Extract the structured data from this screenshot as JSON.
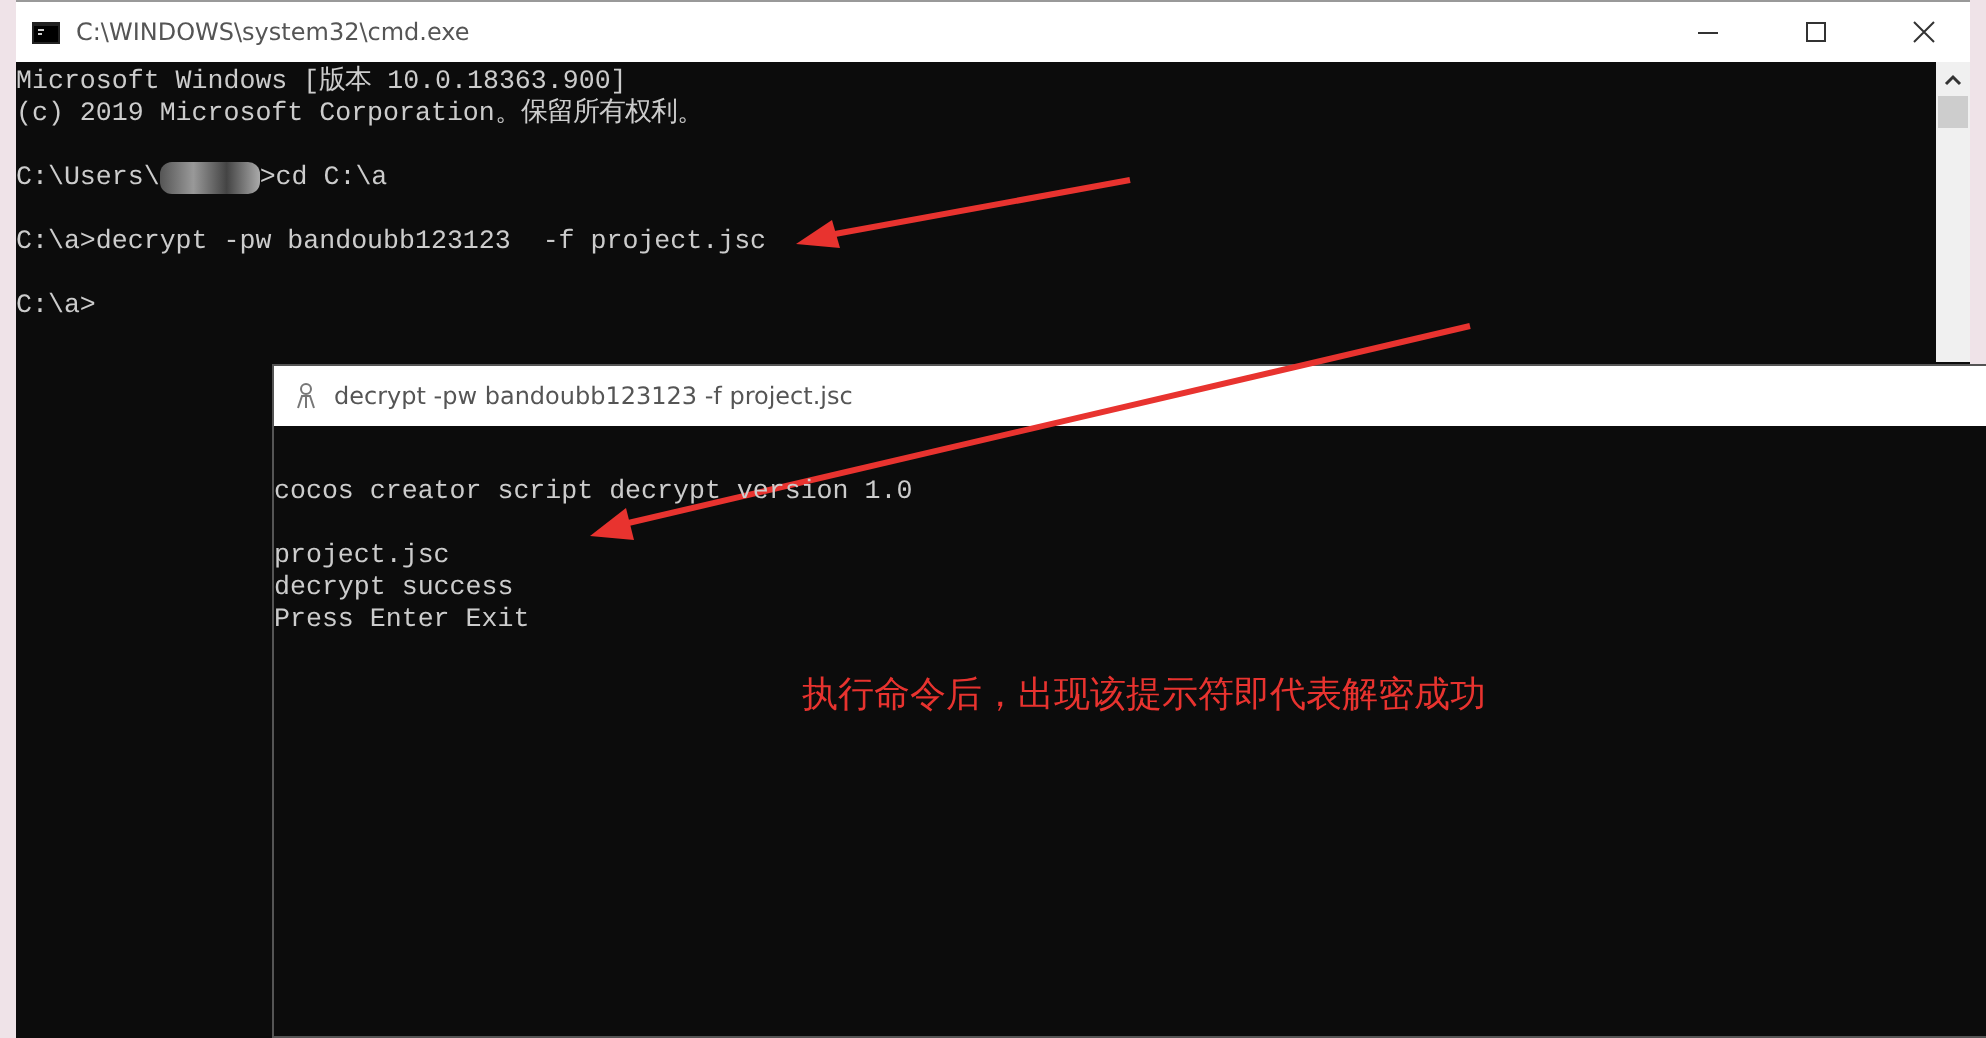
{
  "back_window": {
    "title": "C:\\WINDOWS\\system32\\cmd.exe",
    "lines": [
      {
        "kind": "text",
        "text": "Microsoft Windows [版本 10.0.18363.900]"
      },
      {
        "kind": "text",
        "text": "(c) 2019 Microsoft Corporation。保留所有权利。"
      },
      {
        "kind": "blank"
      },
      {
        "kind": "redacted",
        "text": "C:\\Users\\",
        "after": ">cd C:\\a"
      },
      {
        "kind": "blank"
      },
      {
        "kind": "text",
        "text": "C:\\a>decrypt -pw bandoubb123123  -f project.jsc"
      },
      {
        "kind": "blank"
      },
      {
        "kind": "text",
        "text": "C:\\a>"
      }
    ]
  },
  "front_window": {
    "title": "decrypt  -pw bandoubb123123  -f project.jsc",
    "lines": [
      {
        "kind": "blank"
      },
      {
        "kind": "text",
        "text": "cocos creator script decrypt version 1.0"
      },
      {
        "kind": "blank"
      },
      {
        "kind": "text",
        "text": "project.jsc"
      },
      {
        "kind": "text",
        "text": "decrypt success"
      },
      {
        "kind": "text",
        "text": "Press Enter Exit"
      }
    ]
  },
  "annotation": "执行命令后，出现该提示符即代表解密成功"
}
